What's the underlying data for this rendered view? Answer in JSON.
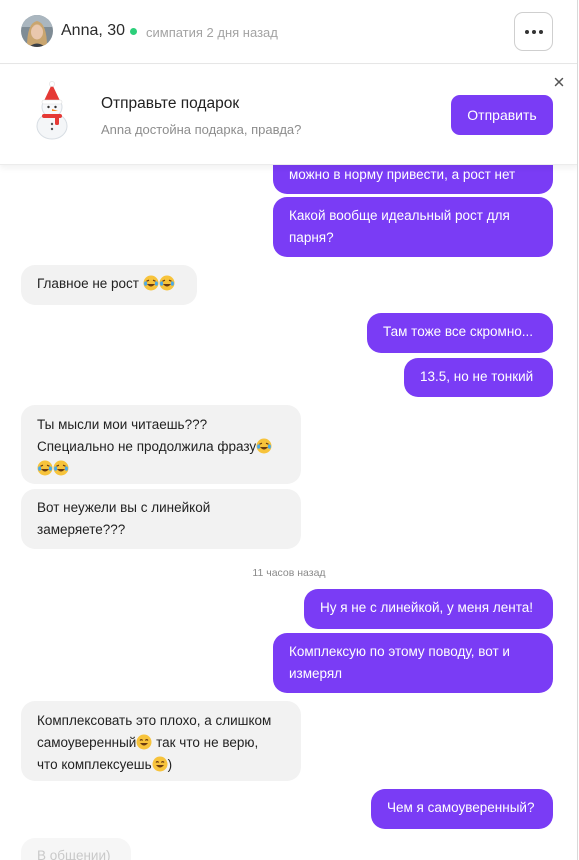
{
  "header": {
    "name": "Anna, 30",
    "status": "симпатия 2 дня назад"
  },
  "gift": {
    "title": "Отправьте подарок",
    "subtitle": "Anna достойна подарка, правда?",
    "send_label": "Отправить"
  },
  "messages": [
    {
      "dir": "out",
      "text": "можно в норму привести, а рост нет"
    },
    {
      "dir": "out",
      "text": "Какой вообще идеальный рост для парня?"
    },
    {
      "dir": "in",
      "text": "Главное не рост"
    },
    {
      "dir": "out",
      "text": "Там тоже все скромно..."
    },
    {
      "dir": "out",
      "text": "13.5, но не тонкий"
    },
    {
      "dir": "in",
      "text": "Ты мысли мои читаешь??? Специально не продолжила фразу"
    },
    {
      "dir": "in",
      "text": "Вот неужели вы с линейкой замеряете???"
    },
    {
      "dir": "out",
      "text": "Ну я не с линейкой, у меня лента!"
    },
    {
      "dir": "out",
      "text": "Комплексую по этому поводу, вот и измерял"
    },
    {
      "dir": "in",
      "text": "Комплексовать это плохо, а слишком самоуверенный так что не верю, что комплексуешь)"
    },
    {
      "dir": "out",
      "text": "Чем я самоуверенный?"
    },
    {
      "dir": "in",
      "text": "В общении)"
    }
  ],
  "time_separator": "11 часов назад",
  "colors": {
    "accent": "#7a3cf5",
    "incoming_bubble": "#f2f2f2",
    "online": "#2ccf7a"
  }
}
